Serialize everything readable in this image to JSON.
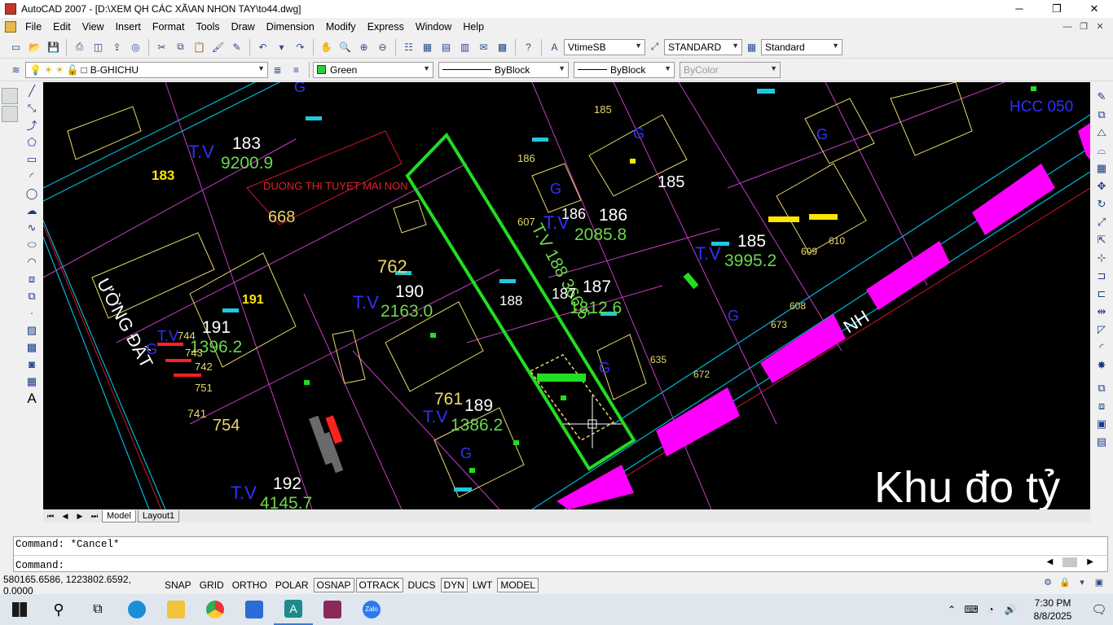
{
  "window": {
    "title": "AutoCAD 2007 - [D:\\XEM QH CÁC XÃ\\AN NHON TAY\\to44.dwg]",
    "controls": [
      "─",
      "❐",
      "✕"
    ]
  },
  "menu": [
    "File",
    "Edit",
    "View",
    "Insert",
    "Format",
    "Tools",
    "Draw",
    "Dimension",
    "Modify",
    "Express",
    "Window",
    "Help"
  ],
  "mdi_controls": [
    "—",
    "❐",
    "✕"
  ],
  "toolbar1": {
    "text_style": "VtimeSB",
    "dim_style": "STANDARD",
    "table_style": "Standard"
  },
  "toolbar2": {
    "layer": "B-GHICHU",
    "color": "Green",
    "color_hex": "#2ecc40",
    "linetype": "ByBlock",
    "lineweight": "ByBlock",
    "plotstyle": "ByColor"
  },
  "drawing": {
    "watermark": "Khu đo tỷ",
    "labels": {
      "tv": "T.V",
      "n183": "183",
      "a183": "9200.9",
      "owner": "DUONG THI TUYET MAI NON",
      "y183": "183",
      "y668": "668",
      "road": "ƯỜNG ĐẤT",
      "y762": "762",
      "n190": "190",
      "a190": "2163.0",
      "y191": "191",
      "n191": "191",
      "a191": "1396.2",
      "y744": "744",
      "y743": "743",
      "y742": "742",
      "y751": "751",
      "y741": "741",
      "y754": "754",
      "n192": "192",
      "a192": "4145.7",
      "y761": "761",
      "n189": "189",
      "a189": "1386.2",
      "strip": "T.V 188 366.6",
      "n188": "188",
      "n187": "187",
      "a187": "1812.6",
      "n186": "186",
      "n186b": "186",
      "a186": "2085.8",
      "y186": "186",
      "y607": "607",
      "y185": "185",
      "n185": "185",
      "n185b": "185",
      "a185": "3995.2",
      "y609": "609",
      "y610": "610",
      "y608": "608",
      "y673": "673",
      "y672": "672",
      "y635": "635",
      "road2": "NH",
      "hcc": "HCC 050",
      "g": "G"
    }
  },
  "tabs": [
    "Model",
    "Layout1"
  ],
  "tab_nav": [
    "⏮",
    "◀",
    "▶",
    "⏭"
  ],
  "command": {
    "line1": "Command: *Cancel*",
    "line2": "Command:"
  },
  "status": {
    "coords": "580165.6586, 1223802.6592, 0.0000",
    "buttons": [
      "SNAP",
      "GRID",
      "ORTHO",
      "POLAR",
      "OSNAP",
      "OTRACK",
      "DUCS",
      "DYN",
      "LWT",
      "MODEL"
    ]
  },
  "clock": {
    "time": "7:30 PM",
    "date": "8/8/2025"
  },
  "taskbar_icons": [
    "start-icon",
    "search-icon",
    "task-view-icon",
    "edge-icon",
    "file-explorer-icon",
    "chrome-icon",
    "store-icon",
    "autocad-icon",
    "winrar-icon",
    "zalo-icon"
  ],
  "zalo_label": "Zalo",
  "autocad_label": "A"
}
